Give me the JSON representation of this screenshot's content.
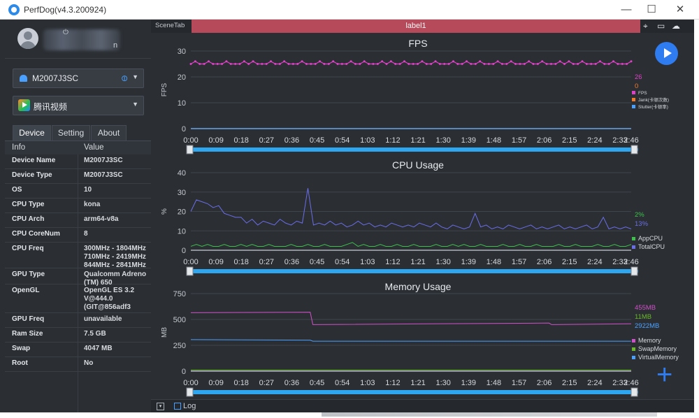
{
  "window": {
    "title": "PerfDog(v4.3.200924)",
    "minimize": "—",
    "maximize": "☐",
    "close": "✕"
  },
  "user": {
    "power_glyph": "⏻",
    "name_suffix": "n"
  },
  "device_selector": {
    "label": "M2007J3SC"
  },
  "app_selector": {
    "label": "腾讯视频"
  },
  "tabs": [
    "Device",
    "Setting",
    "About"
  ],
  "info": {
    "headers": [
      "Info",
      "Value"
    ],
    "rows": [
      {
        "key": "Device Name",
        "value": "M2007J3SC"
      },
      {
        "key": "Device Type",
        "value": "M2007J3SC"
      },
      {
        "key": "OS",
        "value": "10"
      },
      {
        "key": "CPU Type",
        "value": "kona"
      },
      {
        "key": "CPU Arch",
        "value": "arm64-v8a"
      },
      {
        "key": "CPU CoreNum",
        "value": "8"
      },
      {
        "key": "CPU Freq",
        "value": "300MHz - 1804MHz\n710MHz - 2419MHz\n844MHz - 2841MHz"
      },
      {
        "key": "GPU Type",
        "value": "Qualcomm Adreno (TM) 650"
      },
      {
        "key": "OpenGL",
        "value": "OpenGL ES 3.2 V@444.0 (GIT@856adf3"
      },
      {
        "key": "GPU Freq",
        "value": "unavailable"
      },
      {
        "key": "Ram Size",
        "value": "7.5 GB"
      },
      {
        "key": "Swap",
        "value": "4047 MB"
      },
      {
        "key": "Root",
        "value": "No"
      }
    ]
  },
  "scene": {
    "tab_label": "SceneTab",
    "label": "label1"
  },
  "bottom": {
    "toggle_glyph": "▾",
    "log_label": "Log"
  },
  "colors": {
    "accent": "#2f7cf0",
    "scene": "#b74a5a",
    "fps": "#e040c8",
    "jank": "#f07a2a",
    "stutter": "#4aa0ff",
    "app_cpu": "#3cc04a",
    "total_cpu": "#6a6ee8",
    "memory": "#d050c8",
    "swap": "#6ab82a",
    "virtual": "#4aa0ff"
  },
  "chart_data": [
    {
      "type": "line",
      "title": "FPS",
      "ylabel": "FPS",
      "ylim": [
        0,
        30
      ],
      "yticks": [
        0,
        10,
        20,
        30
      ],
      "xticks": [
        "0:00",
        "0:09",
        "0:18",
        "0:27",
        "0:36",
        "0:45",
        "0:54",
        "1:03",
        "1:12",
        "1:21",
        "1:30",
        "1:39",
        "1:48",
        "1:57",
        "2:06",
        "2:15",
        "2:24",
        "2:33",
        "2:46"
      ],
      "current_values": [
        "26",
        "0"
      ],
      "legend": [
        "FPS",
        "Jank(卡顿次数)",
        "Stutter(卡顿率)"
      ],
      "series": [
        {
          "name": "FPS",
          "values": [
            25,
            26,
            25,
            25,
            26,
            25,
            25,
            25,
            26,
            25,
            25,
            25,
            26,
            25,
            26,
            25,
            25,
            25,
            26,
            25,
            25,
            26,
            25,
            25,
            25,
            26,
            25,
            25,
            25,
            26,
            25,
            25,
            26,
            25,
            25,
            25,
            26,
            25,
            25,
            26,
            25,
            25,
            25,
            26,
            25,
            26,
            25,
            25,
            26,
            25,
            25,
            25,
            26,
            25,
            25,
            26,
            25,
            25,
            25,
            26,
            25,
            25,
            26,
            25,
            25,
            26,
            25,
            25,
            25,
            26,
            25,
            25,
            26,
            25,
            25,
            25,
            26,
            25,
            25,
            26,
            25,
            25,
            25,
            26,
            25,
            26,
            25,
            25,
            26,
            25,
            25,
            25,
            26,
            25,
            25,
            26,
            25,
            25,
            25,
            26
          ]
        },
        {
          "name": "Jank(卡顿次数)",
          "values": [
            0,
            0
          ]
        },
        {
          "name": "Stutter(卡顿率)",
          "values": [
            0,
            0
          ]
        }
      ]
    },
    {
      "type": "line",
      "title": "CPU Usage",
      "ylabel": "%",
      "ylim": [
        0,
        40
      ],
      "yticks": [
        0,
        10,
        20,
        30,
        40
      ],
      "xticks": [
        "0:00",
        "0:09",
        "0:18",
        "0:27",
        "0:36",
        "0:45",
        "0:54",
        "1:03",
        "1:12",
        "1:21",
        "1:30",
        "1:39",
        "1:48",
        "1:57",
        "2:06",
        "2:15",
        "2:24",
        "2:33",
        "2:46"
      ],
      "current_values": [
        "2%",
        "13%"
      ],
      "legend": [
        "AppCPU",
        "TotalCPU"
      ],
      "series": [
        {
          "name": "AppCPU",
          "values": [
            2,
            3,
            2,
            3,
            2,
            2,
            3,
            2,
            2,
            3,
            2,
            3,
            2,
            2,
            3,
            2,
            2,
            2,
            3,
            2,
            2,
            3,
            2,
            2,
            3,
            2,
            2,
            2,
            3,
            4,
            2,
            3,
            2,
            2,
            3,
            2,
            2,
            3,
            2,
            2,
            3,
            2,
            2,
            2,
            3,
            2,
            2,
            3,
            2,
            3,
            2,
            2,
            3,
            2,
            2,
            2,
            3,
            2,
            2,
            3,
            2,
            2,
            3,
            2,
            2,
            2,
            3,
            2,
            2,
            3,
            2,
            2,
            2,
            3,
            2,
            2,
            3,
            2,
            2,
            3
          ]
        },
        {
          "name": "TotalCPU",
          "values": [
            20,
            26,
            25,
            24,
            22,
            23,
            19,
            18,
            17,
            17,
            14,
            16,
            13,
            15,
            14,
            13,
            16,
            14,
            13,
            15,
            14,
            32,
            13,
            14,
            13,
            15,
            13,
            14,
            12,
            13,
            15,
            13,
            14,
            12,
            13,
            12,
            14,
            13,
            12,
            13,
            12,
            14,
            13,
            12,
            14,
            12,
            11,
            13,
            12,
            11,
            12,
            19,
            12,
            13,
            11,
            12,
            11,
            13,
            12,
            11,
            12,
            13,
            11,
            12,
            11,
            12,
            13,
            11,
            12,
            11,
            12,
            13,
            11,
            12,
            17,
            11,
            12,
            11,
            12,
            11
          ]
        }
      ]
    },
    {
      "type": "line",
      "title": "Memory Usage",
      "ylabel": "MB",
      "ylim": [
        0,
        750
      ],
      "yticks": [
        0,
        250,
        500,
        750
      ],
      "xticks": [
        "0:00",
        "0:09",
        "0:18",
        "0:27",
        "0:36",
        "0:45",
        "0:54",
        "1:03",
        "1:12",
        "1:21",
        "1:30",
        "1:39",
        "1:48",
        "1:57",
        "2:06",
        "2:15",
        "2:24",
        "2:33",
        "2:46"
      ],
      "current_values": [
        "455MB",
        "11MB",
        "2922MB"
      ],
      "legend": [
        "Memory",
        "SwapMemory",
        "VirtualMemory"
      ],
      "series": [
        {
          "name": "Memory",
          "x": [
            0,
            45,
            46,
            135,
            136,
            166
          ],
          "values": [
            565,
            570,
            450,
            465,
            450,
            458
          ]
        },
        {
          "name": "SwapMemory",
          "x": [
            0,
            166
          ],
          "values": [
            11,
            11
          ]
        },
        {
          "name": "VirtualMemory",
          "x": [
            0,
            45,
            46,
            166
          ],
          "values": [
            305,
            300,
            290,
            290
          ]
        }
      ]
    }
  ]
}
